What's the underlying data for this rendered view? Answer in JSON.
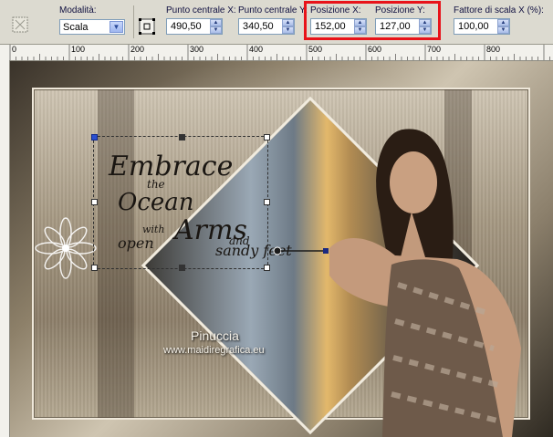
{
  "toolbar": {
    "mode_label": "Modalità:",
    "mode_value": "Scala",
    "center_x_label": "Punto centrale X:",
    "center_x_value": "490,50",
    "center_y_label": "Punto centrale Y:",
    "center_y_value": "340,50",
    "pos_x_label": "Posizione X:",
    "pos_x_value": "152,00",
    "pos_y_label": "Posizione Y:",
    "pos_y_value": "127,00",
    "scale_x_label": "Fattore di scala X (%):",
    "scale_x_value": "100,00"
  },
  "ruler": {
    "labels": [
      "0",
      "100",
      "200",
      "300",
      "400",
      "500",
      "600",
      "700",
      "800"
    ]
  },
  "canvas": {
    "script_text": {
      "line1": "Embrace",
      "line2": "the",
      "line3": "Ocean",
      "line4": "with",
      "line5": "open",
      "line6": "Arms",
      "line7": "and",
      "line8": "sandy feet"
    },
    "watermark_name": "Pinuccia",
    "watermark_url": "www.maidiregrafica.eu"
  },
  "colors": {
    "highlight": "#e8131a",
    "toolbar_bg": "#dcdad0"
  },
  "icons": [
    "tool-icon",
    "move-center-icon",
    "spin-up-icon",
    "spin-down-icon",
    "dropdown-arrow-icon",
    "flower-icon"
  ]
}
